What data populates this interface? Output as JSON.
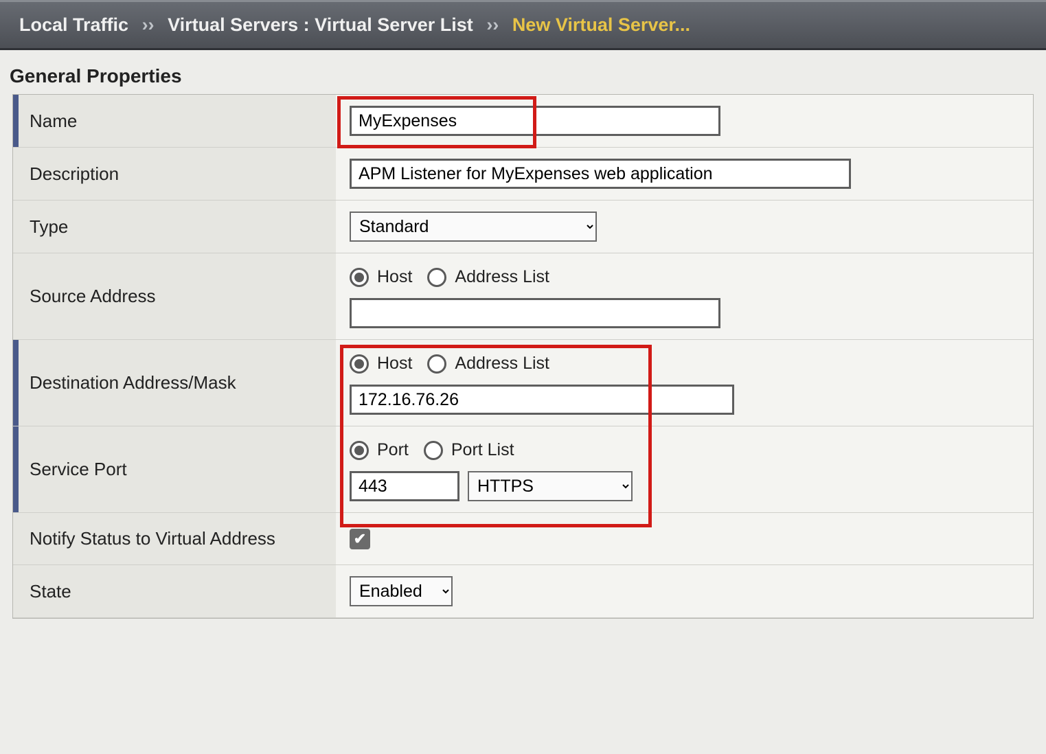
{
  "breadcrumb": {
    "seg1": "Local Traffic",
    "seg2": "Virtual Servers : Virtual Server List",
    "seg3": "New Virtual Server...",
    "sep": "››"
  },
  "section_title": "General Properties",
  "rows": {
    "name": {
      "label": "Name",
      "value": "MyExpenses"
    },
    "description": {
      "label": "Description",
      "value": "APM Listener for MyExpenses web application"
    },
    "type": {
      "label": "Type",
      "value": "Standard"
    },
    "source": {
      "label": "Source Address",
      "radio_host": "Host",
      "radio_list": "Address List",
      "value": ""
    },
    "dest": {
      "label": "Destination Address/Mask",
      "radio_host": "Host",
      "radio_list": "Address List",
      "value": "172.16.76.26"
    },
    "port": {
      "label": "Service Port",
      "radio_port": "Port",
      "radio_list": "Port List",
      "value": "443",
      "proto": "HTTPS"
    },
    "notify": {
      "label": "Notify Status to Virtual Address",
      "checked": true
    },
    "state": {
      "label": "State",
      "value": "Enabled"
    }
  }
}
